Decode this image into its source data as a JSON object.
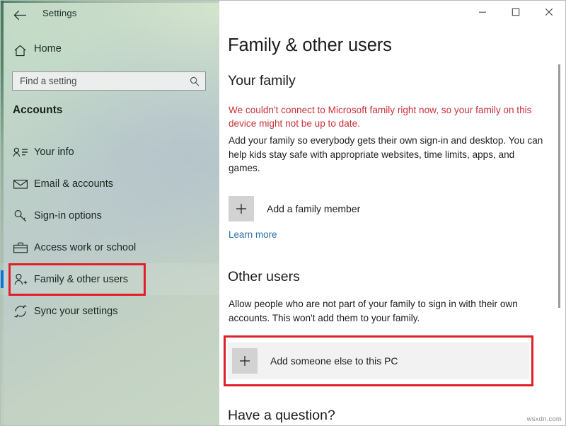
{
  "window": {
    "app_title": "Settings",
    "back_icon": "back-arrow-icon",
    "controls": {
      "minimize": "minimize-icon",
      "maximize": "maximize-icon",
      "close": "close-icon"
    }
  },
  "sidebar": {
    "home": {
      "label": "Home",
      "icon": "home-icon"
    },
    "search": {
      "placeholder": "Find a setting",
      "value": "",
      "icon": "search-icon"
    },
    "section_title": "Accounts",
    "items": [
      {
        "label": "Your info",
        "icon": "contact-card-icon",
        "selected": false
      },
      {
        "label": "Email & accounts",
        "icon": "envelope-icon",
        "selected": false
      },
      {
        "label": "Sign-in options",
        "icon": "key-icon",
        "selected": false
      },
      {
        "label": "Access work or school",
        "icon": "briefcase-icon",
        "selected": false
      },
      {
        "label": "Family & other users",
        "icon": "person-add-icon",
        "selected": true
      },
      {
        "label": "Sync your settings",
        "icon": "sync-icon",
        "selected": false
      }
    ]
  },
  "main": {
    "page_title": "Family & other users",
    "your_family": {
      "heading": "Your family",
      "error_text": "We couldn't connect to Microsoft family right now, so your family on this device might not be up to date.",
      "description": "Add your family so everybody gets their own sign-in and desktop. You can help kids stay safe with appropriate websites, time limits, apps, and games.",
      "add_button_label": "Add a family member",
      "add_button_icon": "plus-icon",
      "learn_more_label": "Learn more"
    },
    "other_users": {
      "heading": "Other users",
      "description": "Allow people who are not part of your family to sign in with their own accounts. This won't add them to your family.",
      "add_button_label": "Add someone else to this PC",
      "add_button_icon": "plus-icon"
    },
    "question_heading": "Have a question?"
  },
  "annotations": {
    "highlight_color": "#e02027",
    "boxes": [
      "Family & other users",
      "Add someone else to this PC"
    ]
  },
  "watermark": "wsxdn.com",
  "colors": {
    "accent": "#0078d7",
    "error": "#c8303a",
    "link": "#2a6fa8",
    "highlight": "#e02027",
    "tile": "#d2d2d2"
  }
}
